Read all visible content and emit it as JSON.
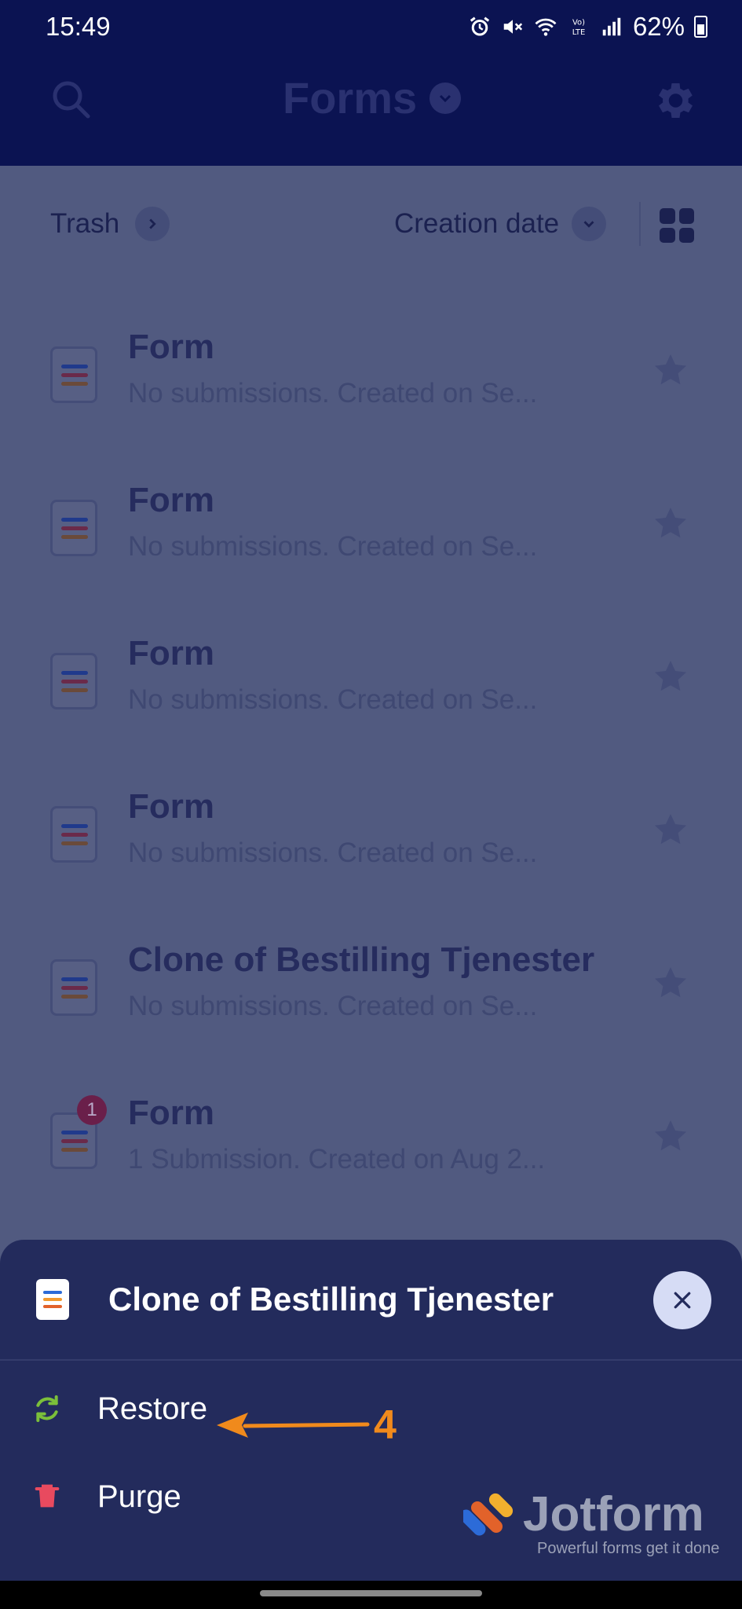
{
  "status_bar": {
    "time": "15:49",
    "battery": "62%"
  },
  "header": {
    "title": "Forms",
    "icons": {
      "search": "search-icon",
      "settings": "gear-icon",
      "title_menu": "chevron-down-icon"
    }
  },
  "toolbar": {
    "trash_label": "Trash",
    "sort_label": "Creation date"
  },
  "forms": [
    {
      "name": "Form",
      "meta": "No submissions. Created on Se...",
      "badge": ""
    },
    {
      "name": "Form",
      "meta": "No submissions. Created on Se...",
      "badge": ""
    },
    {
      "name": "Form",
      "meta": "No submissions. Created on Se...",
      "badge": ""
    },
    {
      "name": "Form",
      "meta": "No submissions. Created on Se...",
      "badge": ""
    },
    {
      "name": "Clone of Bestilling Tjenester",
      "meta": "No submissions. Created on Se...",
      "badge": ""
    },
    {
      "name": "Form",
      "meta": "1 Submission. Created on Aug 2...",
      "badge": "1"
    }
  ],
  "sheet": {
    "title": "Clone of Bestilling Tjenester",
    "actions": [
      {
        "label": "Restore",
        "icon": "restore-icon",
        "color": "#7bbf3a"
      },
      {
        "label": "Purge",
        "icon": "trash-icon",
        "color": "#e84a5f"
      }
    ]
  },
  "annotation": {
    "number": "4",
    "color": "#f08a1c"
  },
  "watermark": {
    "name": "Jotform",
    "tagline": "Powerful forms get it done"
  },
  "colors": {
    "header_bg": "#0b1352",
    "overlay_bg": "#515a80",
    "sheet_bg": "#232b5c"
  }
}
